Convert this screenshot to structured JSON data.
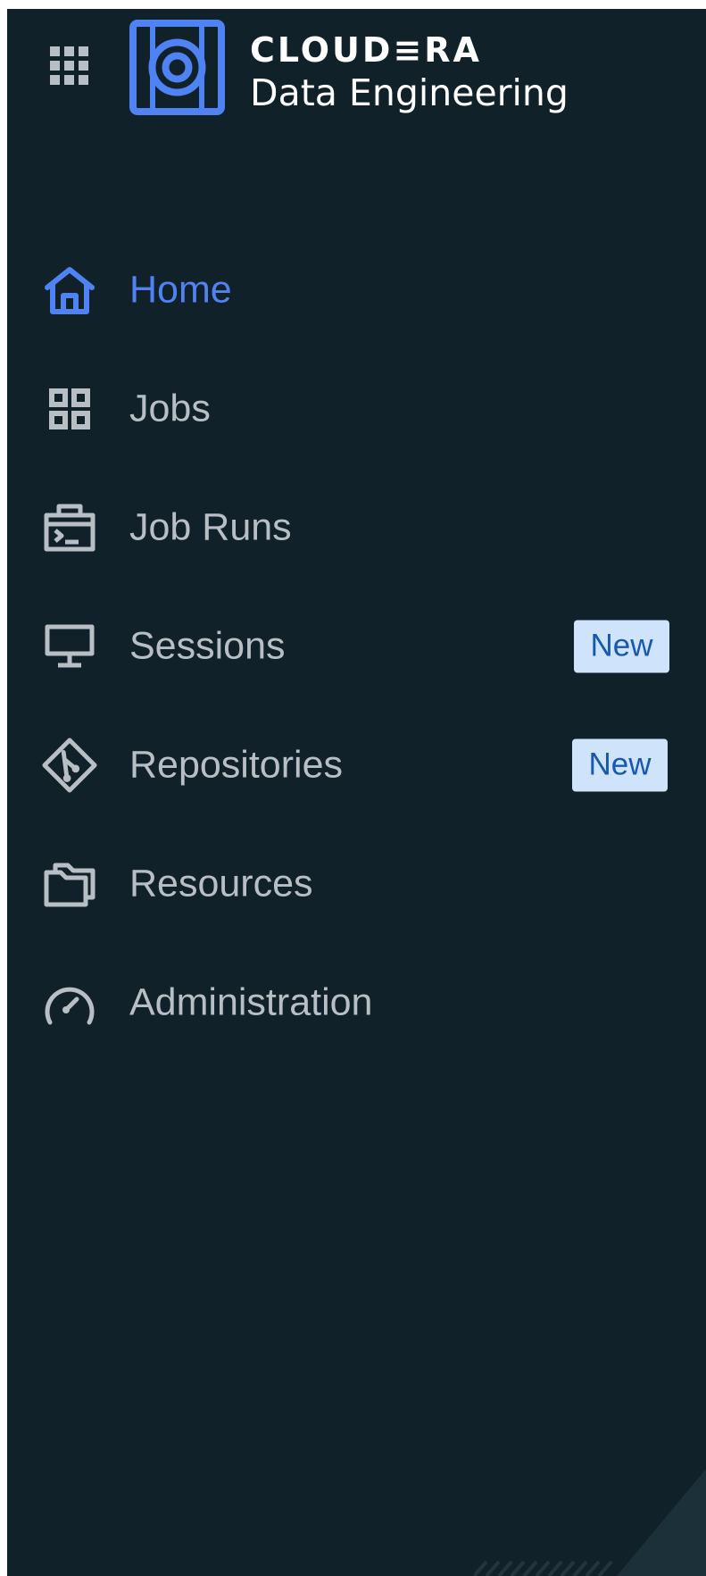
{
  "brand": {
    "company": "CLOUD≡RA",
    "product": "Data Engineering"
  },
  "colors": {
    "background": "#11212a",
    "accent": "#4f82f3",
    "nav_text": "#b8bfc4",
    "badge_bg": "#cfe4fa",
    "badge_text": "#1758b0"
  },
  "nav": {
    "items": [
      {
        "label": "Home",
        "icon": "home-icon",
        "active": true
      },
      {
        "label": "Jobs",
        "icon": "jobs-grid-icon"
      },
      {
        "label": "Job Runs",
        "icon": "terminal-briefcase-icon"
      },
      {
        "label": "Sessions",
        "icon": "monitor-icon",
        "badge": "New"
      },
      {
        "label": "Repositories",
        "icon": "git-diamond-icon",
        "badge": "New"
      },
      {
        "label": "Resources",
        "icon": "folders-icon"
      },
      {
        "label": "Administration",
        "icon": "gauge-icon"
      }
    ]
  }
}
